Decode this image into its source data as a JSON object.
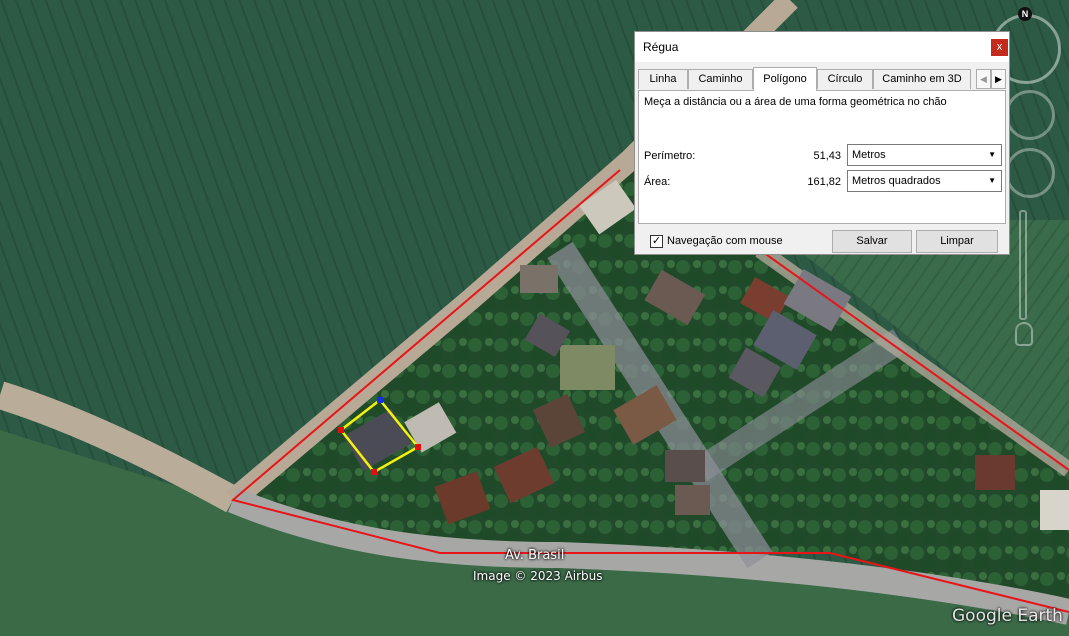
{
  "map": {
    "street_label": "Av. Brasil",
    "credit": "Image © 2023 Airbus",
    "brand": "Google Earth",
    "north_label": "N"
  },
  "ruler": {
    "title": "Régua",
    "close_label": "x",
    "tabs": [
      "Linha",
      "Caminho",
      "Polígono",
      "Círculo",
      "Caminho em 3D"
    ],
    "active_tab": "Polígono",
    "scroll_left": "◀",
    "scroll_right": "▶",
    "description": "Meça a distância ou a área de uma forma geométrica no chão",
    "perimeter": {
      "label": "Perímetro:",
      "value": "51,43",
      "unit": "Metros"
    },
    "area": {
      "label": "Área:",
      "value": "161,82",
      "unit": "Metros quadrados"
    },
    "mouse_nav": {
      "label": "Navegação com mouse",
      "checked": true,
      "check_glyph": "✓"
    },
    "save_label": "Salvar",
    "clear_label": "Limpar",
    "dropdown_arrow": "▼"
  },
  "colors": {
    "parcel_outline": "#e8141a",
    "measure_polygon": "#f5f20a",
    "vertex_red": "#e01010",
    "vertex_blue": "#1530e0",
    "close_button": "#c42b1c"
  }
}
